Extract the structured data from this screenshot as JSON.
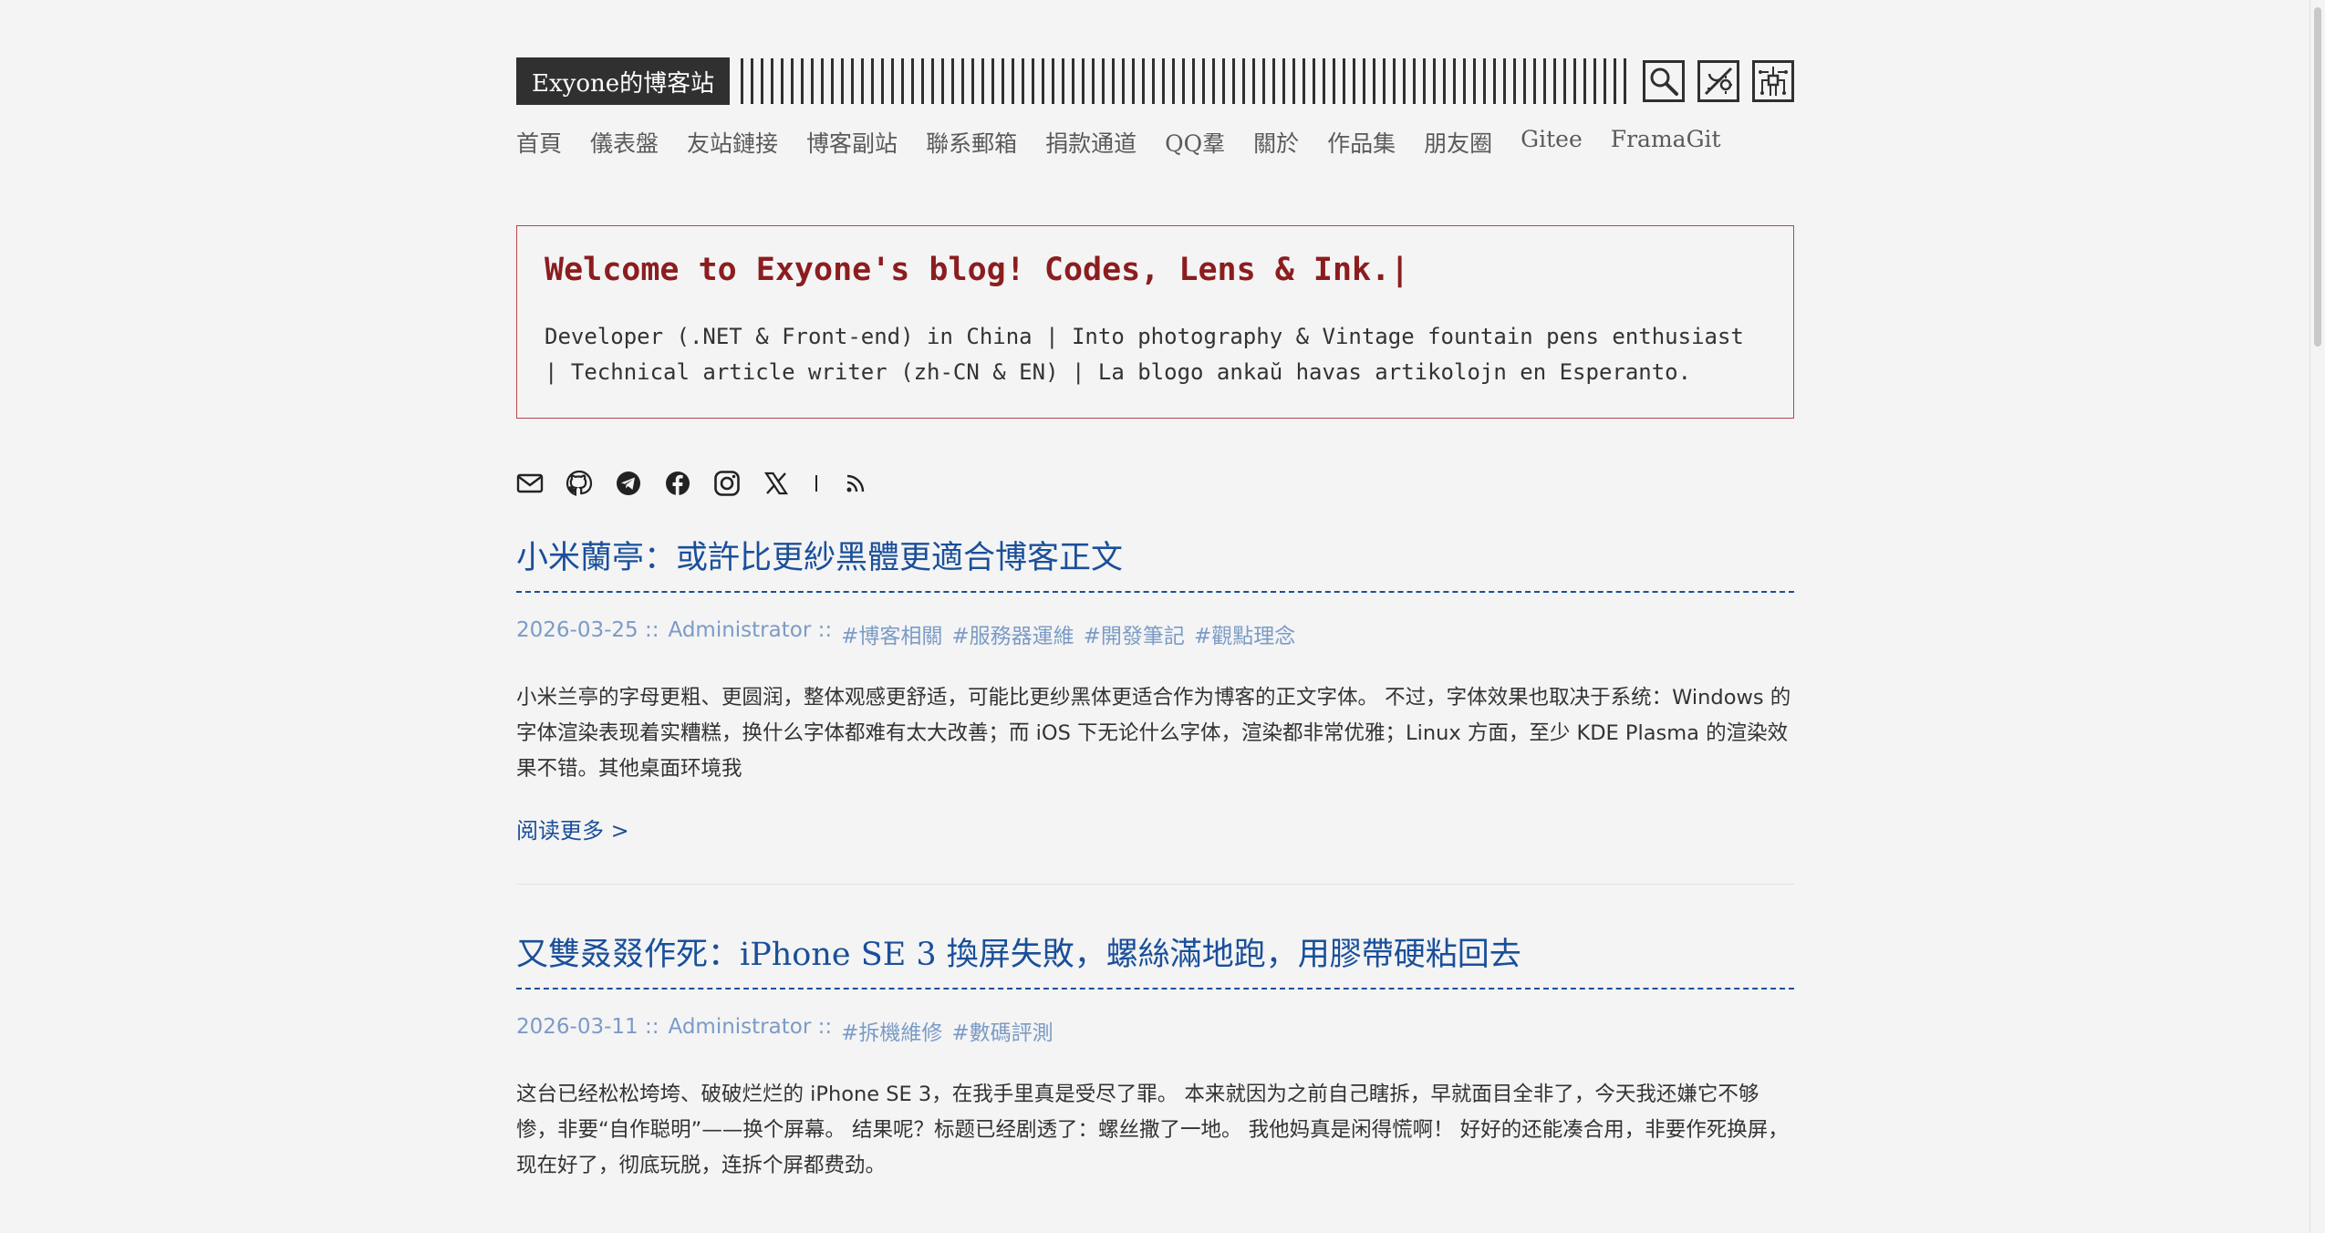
{
  "site": {
    "logo_text": "Exyone的博客站"
  },
  "header_icons": {
    "search": "search-icon",
    "theme": "theme-toggle-icon",
    "circuit": "circuit-icon"
  },
  "nav": {
    "items": [
      "首頁",
      "儀表盤",
      "友站鏈接",
      "博客副站",
      "聯系郵箱",
      "捐款通道",
      "QQ羣",
      "關於",
      "作品集",
      "朋友圈",
      "Gitee",
      "FramaGit"
    ]
  },
  "hero": {
    "title": "Welcome to Exyone's blog! Codes, Lens & Ink.|",
    "description": "Developer (.NET & Front-end) in China | Into photography & Vintage fountain pens enthusiast | Technical article writer (zh-CN & EN) | La blogo ankaŭ havas artikolojn en Esperanto."
  },
  "social": {
    "icons": [
      "mail-icon",
      "github-icon",
      "telegram-icon",
      "facebook-icon",
      "instagram-icon",
      "x-icon",
      "rss-icon"
    ]
  },
  "posts": [
    {
      "title": "小米蘭亭：或許比更紗黑體更適合博客正文",
      "date": "2026-03-25 ::",
      "author": "Administrator ::",
      "tags": [
        "#博客相關",
        "#服務器運維",
        "#開發筆記",
        "#觀點理念"
      ],
      "excerpt": "小米兰亭的字母更粗、更圆润，整体观感更舒适，可能比更纱黑体更适合作为博客的正文字体。 不过，字体效果也取决于系统：Windows 的字体渲染表现着实糟糕，换什么字体都难有太大改善；而 iOS 下无论什么字体，渲染都非常优雅；Linux 方面，至少 KDE Plasma 的渲染效果不错。其他桌面环境我",
      "read_more": "阅读更多 >"
    },
    {
      "title": "又雙叒叕作死：iPhone SE 3 換屏失敗，螺絲滿地跑，用膠帶硬粘回去",
      "date": "2026-03-11 ::",
      "author": "Administrator ::",
      "tags": [
        "#拆機維修",
        "#數碼評測"
      ],
      "excerpt": "这台已经松松垮垮、破破烂烂的 iPhone SE 3，在我手里真是受尽了罪。 本来就因为之前自己瞎拆，早就面目全非了，今天我还嫌它不够惨，非要“自作聪明”——换个屏幕。 结果呢？标题已经剧透了：螺丝撒了一地。 我他妈真是闲得慌啊！ 好好的还能凑合用，非要作死换屏，现在好了，彻底玩脱，连拆个屏都费劲。"
    }
  ]
}
